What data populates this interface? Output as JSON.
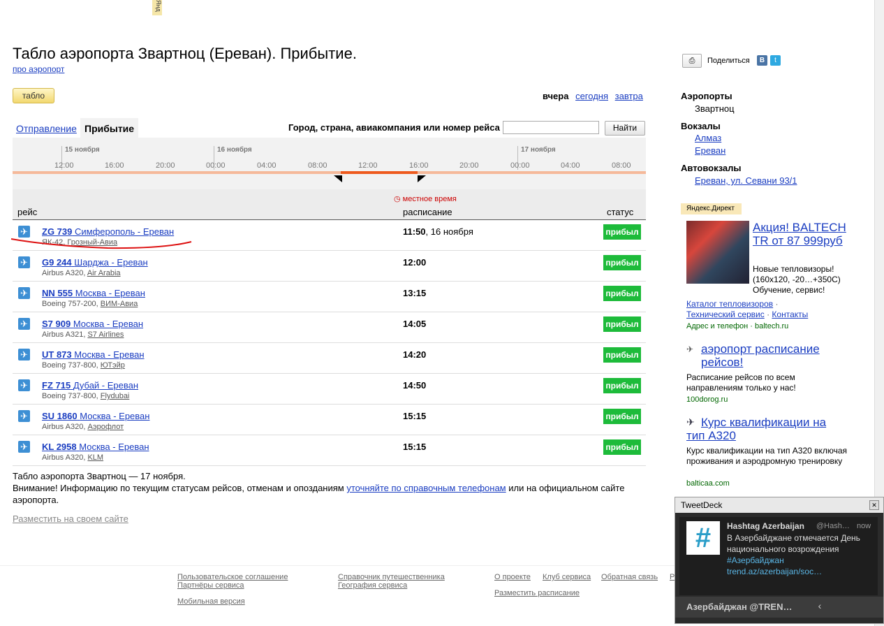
{
  "top_tag": "Янд",
  "title": "Табло аэропорта Звартноц (Ереван). Прибытие.",
  "about_link": "про аэропорт",
  "tablo_button": "табло",
  "day_nav": {
    "yesterday": "вчера",
    "today": "сегодня",
    "tomorrow": "завтра"
  },
  "tabs": {
    "departure": "Отправление",
    "arrival": "Прибытие"
  },
  "search": {
    "label": "Город, страна, авиакомпания или номер рейса",
    "value": "",
    "button": "Найти"
  },
  "timeline": {
    "days": [
      "15 ноября",
      "16 ноября",
      "17 ноября"
    ],
    "hours": [
      "12:00",
      "16:00",
      "20:00",
      "00:00",
      "04:00",
      "08:00",
      "12:00",
      "16:00",
      "20:00",
      "00:00",
      "04:00",
      "08:00"
    ]
  },
  "columns": {
    "flight": "рейс",
    "local_time": "местное время",
    "schedule": "расписание",
    "status": "статус"
  },
  "flights": [
    {
      "num": "ZG 739",
      "route": "Симферополь - Ереван",
      "aircraft": "ЯК-42,",
      "airline": "Грозный-Авиа",
      "time": "11:50",
      "date": ", 16 ноября",
      "status": "прибыл"
    },
    {
      "num": "G9 244",
      "route": "Шарджа - Ереван",
      "aircraft": "Airbus A320,",
      "airline": "Air Arabia",
      "time": "12:00",
      "date": "",
      "status": "прибыл"
    },
    {
      "num": "NN 555",
      "route": "Москва - Ереван",
      "aircraft": "Boeing 757-200,",
      "airline": "ВИМ-Авиа",
      "time": "13:15",
      "date": "",
      "status": "прибыл"
    },
    {
      "num": "S7 909",
      "route": "Москва - Ереван",
      "aircraft": "Airbus A321,",
      "airline": "S7 Airlines",
      "time": "14:05",
      "date": "",
      "status": "прибыл"
    },
    {
      "num": "UT 873",
      "route": "Москва - Ереван",
      "aircraft": "Boeing 737-800,",
      "airline": "ЮТэйр",
      "time": "14:20",
      "date": "",
      "status": "прибыл"
    },
    {
      "num": "FZ 715",
      "route": "Дубай - Ереван",
      "aircraft": "Boeing 737-800,",
      "airline": "Flydubai",
      "time": "14:50",
      "date": "",
      "status": "прибыл"
    },
    {
      "num": "SU 1860",
      "route": "Москва - Ереван",
      "aircraft": "Airbus A320,",
      "airline": "Аэрофлот",
      "time": "15:15",
      "date": "",
      "status": "прибыл"
    },
    {
      "num": "KL 2958",
      "route": "Москва - Ереван",
      "aircraft": "Airbus A320,",
      "airline": "KLM",
      "time": "15:15",
      "date": "",
      "status": "прибыл"
    }
  ],
  "footer_note": {
    "line1": "Табло аэропорта Звартноц  — 17 ноября.",
    "line2_pre": "Внимание! Информацию по текущим статусам рейсов, отменам и опозданиям ",
    "line2_link": "уточняйте по справочным телефонам",
    "line2_post": " или на официальном сайте аэропорта."
  },
  "embed_link": "Разместить на своем сайте",
  "footer_links": {
    "terms": "Пользовательское соглашение",
    "partners": "Партнёры сервиса",
    "mobile": "Мобильная версия",
    "guide": "Справочник путешественника",
    "geo": "География сервиса",
    "about": "О проекте",
    "club": "Клуб сервиса",
    "feedback": "Обратная связь",
    "r": "Р",
    "place_schedule": "Разместить расписание"
  },
  "share": {
    "label": "Поделиться",
    "vk": "В",
    "tw": "t"
  },
  "sidebar": {
    "airports_h": "Аэропорты",
    "airport1": "Звартноц",
    "stations_h": "Вокзалы",
    "station1": "Алмаз",
    "station2": "Ереван",
    "bus_h": "Автовокзалы",
    "bus1": "Ереван, ул. Севани 93/1"
  },
  "direct_tag": "Яндекс.Директ",
  "ads": {
    "a1_title": "Акция! BALTECH TR от 87 999руб",
    "a1_text": "Новые тепловизоры! (160х120, -20…+350С) Обучение, сервис!",
    "a1_link1": "Каталог тепловизоров",
    "a1_link2": "Технический сервис",
    "a1_link3": "Контакты",
    "a1_dom": "Адрес и телефон · baltech.ru",
    "a2_title": "аэропорт расписание рейсов!",
    "a2_text": "Расписание рейсов по всем направлениям только у нас!",
    "a2_dom": "100dorog.ru",
    "a3_title": "Курс квалификации на тип А320",
    "a3_text": "Курс квалификации на тип А320 включая проживания и аэродромную тренировку",
    "a3_dom": "balticaa.com"
  },
  "tweetdeck": {
    "title": "TweetDeck",
    "name": "Hashtag Azerbaijan",
    "handle": "@Hash…",
    "time": "now",
    "text": "В Азербайджане отмечается День национального возрождения",
    "tag": "#Азербайджан",
    "link": "trend.az/azerbaijan/soc…",
    "bar_label": "Азербайджан @TREN…"
  }
}
